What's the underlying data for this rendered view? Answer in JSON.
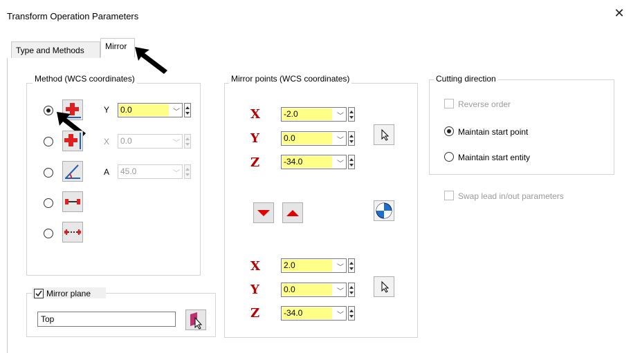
{
  "window": {
    "title": "Transform Operation Parameters",
    "close_glyph": "✕"
  },
  "tabs": [
    {
      "label": "Type and Methods"
    },
    {
      "label": "Mirror"
    }
  ],
  "method": {
    "group_label": "Method (WCS coordinates)",
    "options": [
      {
        "icon": "mirror-y-icon",
        "selected": true,
        "field_label": "Y",
        "value": "0.0",
        "enabled": true
      },
      {
        "icon": "mirror-x-icon",
        "selected": false,
        "field_label": "X",
        "value": "0.0",
        "enabled": false
      },
      {
        "icon": "mirror-angle-icon",
        "selected": false,
        "field_label": "A",
        "value": "45.0",
        "enabled": false
      },
      {
        "icon": "mirror-two-points-icon",
        "selected": false
      },
      {
        "icon": "mirror-dashed-line-icon",
        "selected": false
      }
    ]
  },
  "mirror_plane": {
    "label": "Mirror plane",
    "checked": true,
    "value": "Top"
  },
  "mirror_points": {
    "group_label": "Mirror points (WCS coordinates)",
    "point1": [
      {
        "axis": "X",
        "value": "-2.0"
      },
      {
        "axis": "Y",
        "value": "0.0"
      },
      {
        "axis": "Z",
        "value": "-34.0"
      }
    ],
    "point2": [
      {
        "axis": "X",
        "value": "2.0"
      },
      {
        "axis": "Y",
        "value": "0.0"
      },
      {
        "axis": "Z",
        "value": "-34.0"
      }
    ]
  },
  "cutting_direction": {
    "group_label": "Cutting direction",
    "reverse_order": {
      "label": "Reverse order",
      "checked": false,
      "enabled": false
    },
    "options": [
      {
        "label": "Maintain start point",
        "selected": true
      },
      {
        "label": "Maintain start entity",
        "selected": false
      }
    ]
  },
  "swap_lead": {
    "label": "Swap lead in/out parameters",
    "checked": false,
    "enabled": false
  },
  "colors": {
    "field_highlight": "#ffff88",
    "axis_letter": "#b80000",
    "arrow_red": "#e00000"
  }
}
